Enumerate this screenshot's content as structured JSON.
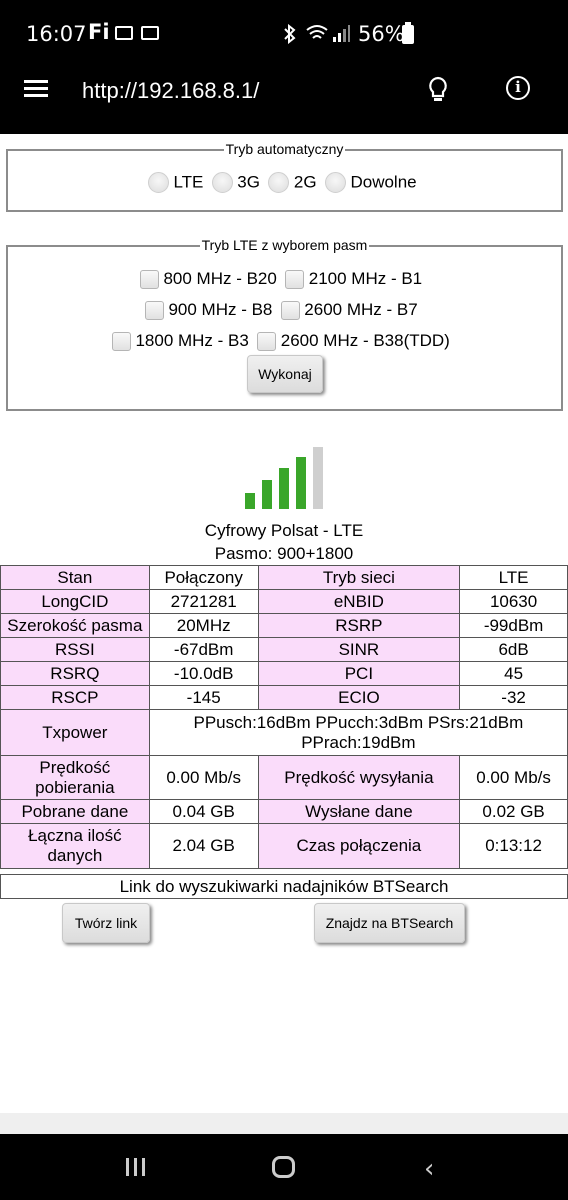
{
  "status_bar": {
    "time": "16:07",
    "carrier_icon": "Fi",
    "battery_percent": "56%"
  },
  "browser": {
    "url": "http://192.168.8.1/"
  },
  "auto_mode": {
    "legend": "Tryb automatyczny",
    "options": [
      "LTE",
      "3G",
      "2G",
      "Dowolne"
    ]
  },
  "lte_bands": {
    "legend": "Tryb LTE z wyborem pasm",
    "bands": [
      "800 MHz - B20",
      "2100 MHz - B1",
      "900 MHz - B8",
      "2600 MHz - B7",
      "1800 MHz - B3",
      "2600 MHz - B38(TDD)"
    ],
    "execute_label": "Wykonaj"
  },
  "signal": {
    "bars_active": 4,
    "bars_total": 5,
    "active_color": "#3aa62a",
    "inactive_color": "#cfcfcf",
    "operator": "Cyfrowy Polsat - LTE",
    "band": "Pasmo: 900+1800"
  },
  "table": {
    "rows": [
      [
        "Stan",
        "Połączony",
        "Tryb sieci",
        "LTE"
      ],
      [
        "LongCID",
        "2721281",
        "eNBID",
        "10630"
      ],
      [
        "Szerokość pasma",
        "20MHz",
        "RSRP",
        "-99dBm"
      ],
      [
        "RSSI",
        "-67dBm",
        "SINR",
        "6dB"
      ],
      [
        "RSRQ",
        "-10.0dB",
        "PCI",
        "45"
      ],
      [
        "RSCP",
        "-145",
        "ECIO",
        "-32"
      ]
    ],
    "txpower_label": "Txpower",
    "txpower_value": "PPusch:16dBm PPucch:3dBm PSrs:21dBm PPrach:19dBm",
    "download_speed_label": "Prędkość pobierania",
    "download_speed_value": "0.00 Mb/s",
    "upload_speed_label": "Prędkość wysyłania",
    "upload_speed_value": "0.00 Mb/s",
    "downloaded_label": "Pobrane dane",
    "downloaded_value": "0.04 GB",
    "uploaded_label": "Wysłane dane",
    "uploaded_value": "0.02 GB",
    "total_label": "Łączna ilość danych",
    "total_value": "2.04 GB",
    "conn_time_label": "Czas połączenia",
    "conn_time_value": "0:13:12"
  },
  "btsearch": {
    "link_text": "Link do wyszukiwarki nadajników BTSearch",
    "create_link_label": "Twórz link",
    "find_label": "Znajdz na BTSearch"
  }
}
